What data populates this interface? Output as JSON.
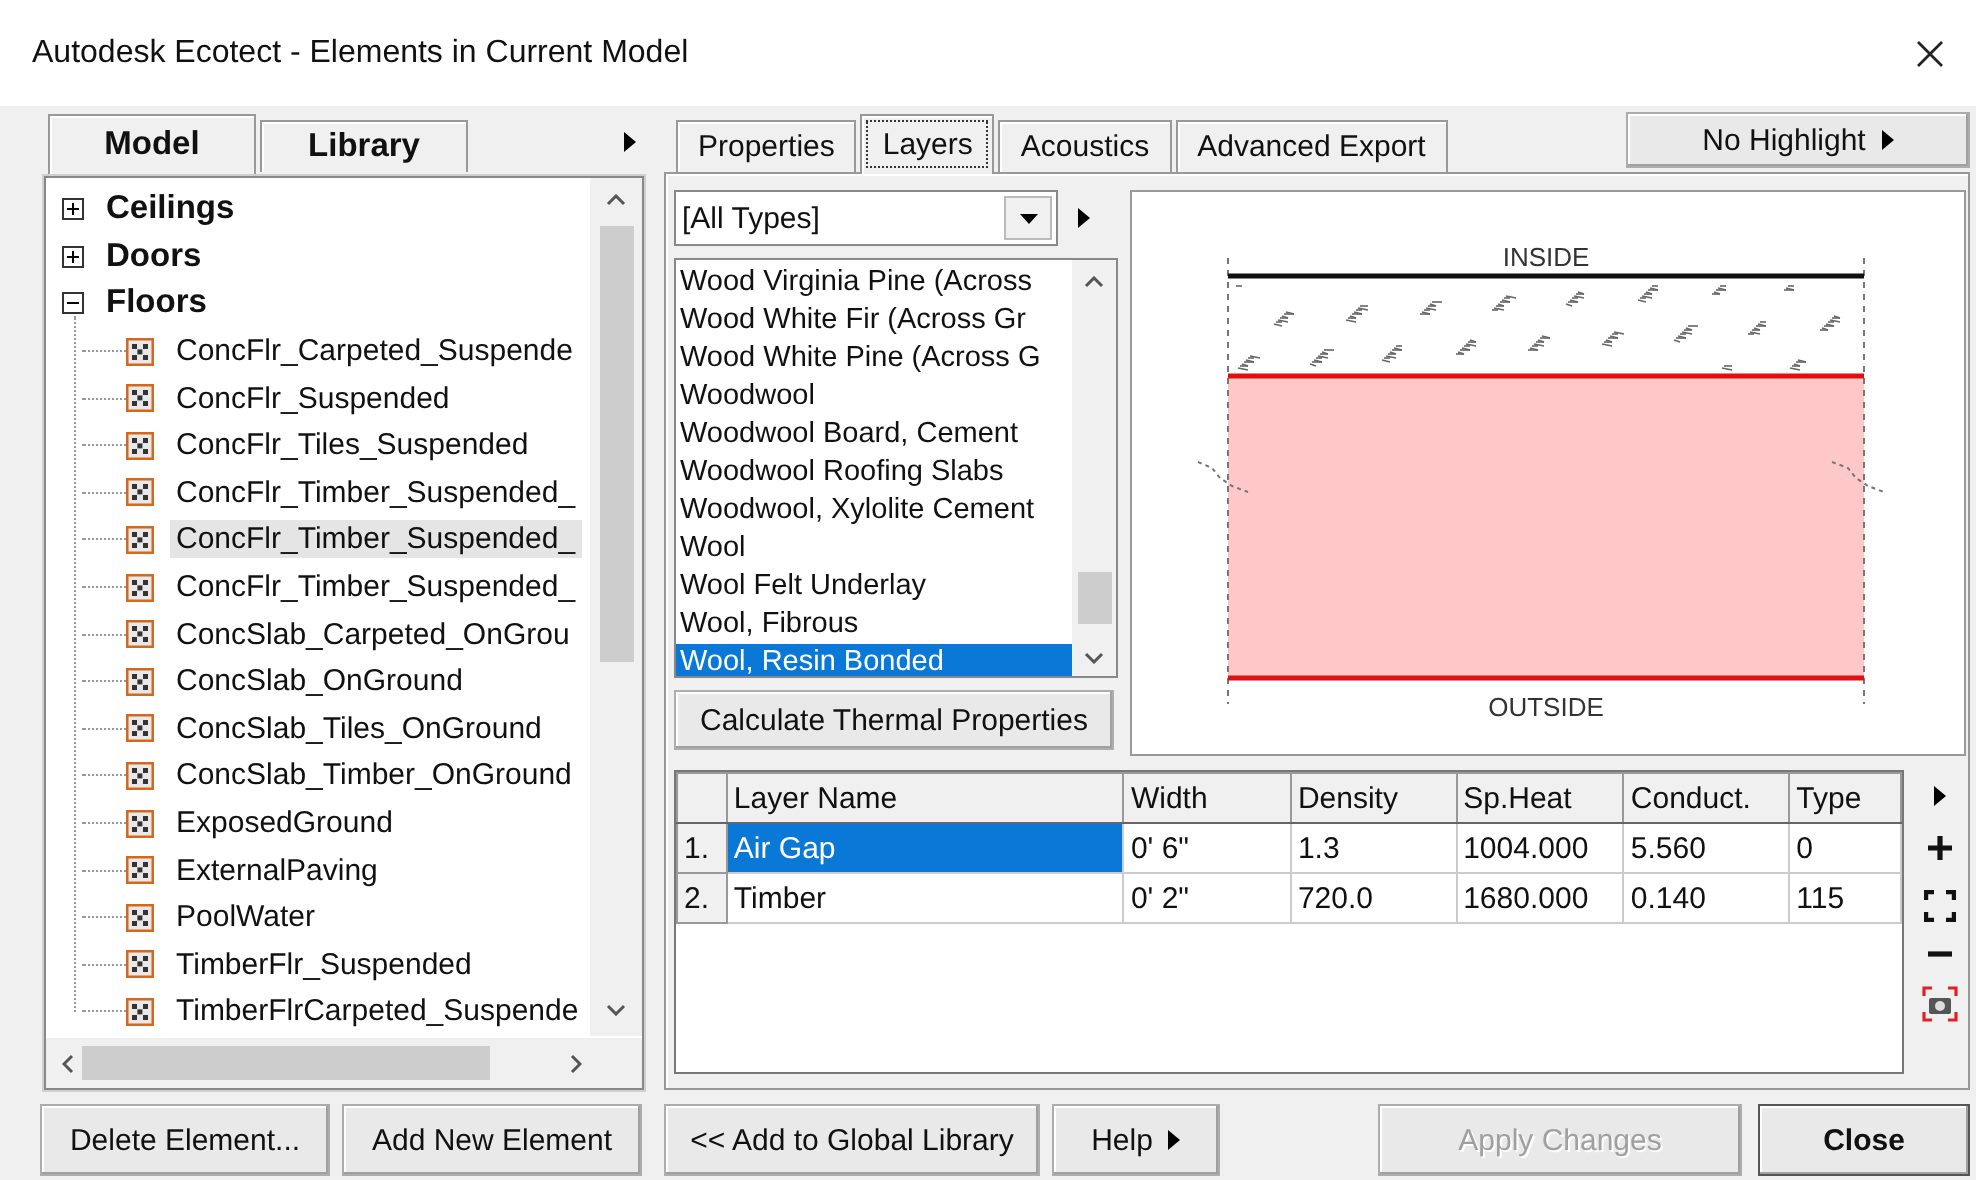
{
  "window": {
    "title": "Autodesk Ecotect - Elements in Current Model"
  },
  "left_tabs": [
    {
      "label": "Model",
      "selected": true
    },
    {
      "label": "Library",
      "selected": false
    }
  ],
  "tree": [
    {
      "label": "Ceilings",
      "expanded": false,
      "selected": false
    },
    {
      "label": "Doors",
      "expanded": false,
      "selected": false
    },
    {
      "label": "Floors",
      "expanded": true,
      "selected": false,
      "children": [
        {
          "label": "ConcFlr_Carpeted_Suspende",
          "selected": false
        },
        {
          "label": "ConcFlr_Suspended",
          "selected": false
        },
        {
          "label": "ConcFlr_Tiles_Suspended",
          "selected": false
        },
        {
          "label": "ConcFlr_Timber_Suspended_",
          "selected": false
        },
        {
          "label": "ConcFlr_Timber_Suspended_",
          "selected": true
        },
        {
          "label": "ConcFlr_Timber_Suspended_",
          "selected": false
        },
        {
          "label": "ConcSlab_Carpeted_OnGrou",
          "selected": false
        },
        {
          "label": "ConcSlab_OnGround",
          "selected": false
        },
        {
          "label": "ConcSlab_Tiles_OnGround",
          "selected": false
        },
        {
          "label": "ConcSlab_Timber_OnGround",
          "selected": false
        },
        {
          "label": "ExposedGround",
          "selected": false
        },
        {
          "label": "ExternalPaving",
          "selected": false
        },
        {
          "label": "PoolWater",
          "selected": false
        },
        {
          "label": "TimberFlr_Suspended",
          "selected": false
        },
        {
          "label": "TimberFlrCarpeted_Suspende",
          "selected": false
        }
      ]
    }
  ],
  "left_buttons": [
    {
      "label": "Delete Element...",
      "disabled": false,
      "default": false,
      "menu": false
    },
    {
      "label": "Add New Element",
      "disabled": false,
      "default": false,
      "menu": false
    }
  ],
  "right_tabs": [
    {
      "label": "Properties",
      "selected": false
    },
    {
      "label": "Layers",
      "selected": true
    },
    {
      "label": "Acoustics",
      "selected": false
    },
    {
      "label": "Advanced Export",
      "selected": false
    }
  ],
  "highlight_button": {
    "label": "No Highlight"
  },
  "type_filter": {
    "value": "[All Types]"
  },
  "materials": [
    {
      "label": "Wood Virginia Pine (Across",
      "selected": false
    },
    {
      "label": "Wood White Fir (Across Gr",
      "selected": false
    },
    {
      "label": "Wood White Pine (Across G",
      "selected": false
    },
    {
      "label": "Woodwool",
      "selected": false
    },
    {
      "label": "Woodwool Board, Cement",
      "selected": false
    },
    {
      "label": "Woodwool Roofing Slabs",
      "selected": false
    },
    {
      "label": "Woodwool, Xylolite Cement",
      "selected": false
    },
    {
      "label": "Wool",
      "selected": false
    },
    {
      "label": "Wool Felt Underlay",
      "selected": false
    },
    {
      "label": "Wool, Fibrous",
      "selected": false
    },
    {
      "label": "Wool, Resin Bonded",
      "selected": true
    }
  ],
  "calc_button": {
    "label": "Calculate Thermal Properties"
  },
  "preview": {
    "inside_label": "INSIDE",
    "outside_label": "OUTSIDE"
  },
  "layers_table": {
    "columns": [
      "Layer Name",
      "Width",
      "Density",
      "Sp.Heat",
      "Conduct.",
      "Type"
    ],
    "rows": [
      {
        "number": "1.",
        "cells": [
          "Air Gap",
          "0' 6\"",
          "1.3",
          "1004.000",
          "5.560",
          "0"
        ],
        "selected": true
      },
      {
        "number": "2.",
        "cells": [
          "Timber",
          "0' 2\"",
          "720.0",
          "1680.000",
          "0.140",
          "115"
        ],
        "selected": false
      }
    ]
  },
  "bottom_buttons": [
    {
      "label": "<< Add to Global Library",
      "disabled": false,
      "default": false,
      "menu": false
    },
    {
      "label": "Help",
      "disabled": false,
      "default": false,
      "menu": true
    },
    {
      "label": "Apply Changes",
      "disabled": true,
      "default": false,
      "menu": false
    },
    {
      "label": "Close",
      "disabled": false,
      "default": true,
      "menu": false
    }
  ]
}
